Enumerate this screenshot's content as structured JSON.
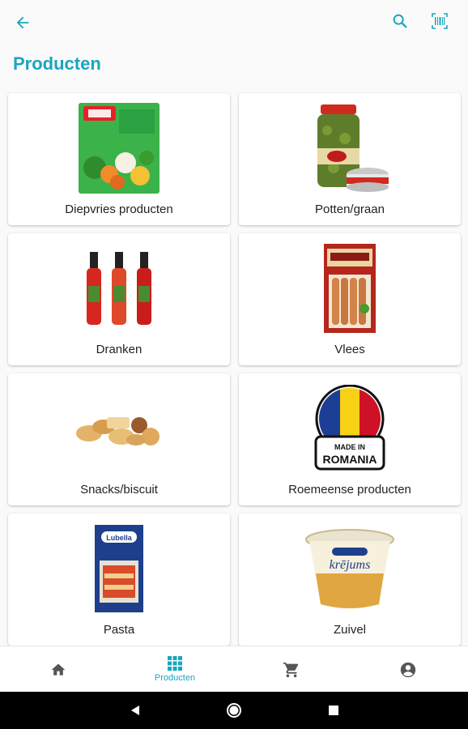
{
  "header": {
    "back_icon": "arrow-left-icon",
    "search_icon": "search-icon",
    "scan_icon": "barcode-scan-icon"
  },
  "page_title": "Producten",
  "colors": {
    "accent": "#19a6bf",
    "text": "#222222",
    "nav_icon": "#555555"
  },
  "categories": [
    {
      "label": "Diepvries producten",
      "image": "frozen-vegetables-bag-image"
    },
    {
      "label": "Potten/graan",
      "image": "pickle-jar-and-can-image"
    },
    {
      "label": "Dranken",
      "image": "sauce-bottles-image"
    },
    {
      "label": "Vlees",
      "image": "sausage-package-image"
    },
    {
      "label": "Snacks/biscuit",
      "image": "biscuits-image"
    },
    {
      "label": "Roemeense producten",
      "image": "made-in-romania-badge-image",
      "badge_text_1": "MADE IN",
      "badge_text_2": "ROMANIA"
    },
    {
      "label": "Pasta",
      "image": "lasagne-box-image",
      "brand_text": "Lubella"
    },
    {
      "label": "Zuivel",
      "image": "cream-cup-image",
      "brand_text": "krējums"
    }
  ],
  "bottom_nav": {
    "home_icon": "home-icon",
    "products_icon": "grid-icon",
    "products_label": "Producten",
    "cart_icon": "cart-icon",
    "account_icon": "account-circle-icon"
  },
  "system_nav": {
    "back": "triangle-back-icon",
    "home": "circle-home-icon",
    "recents": "square-recents-icon"
  }
}
